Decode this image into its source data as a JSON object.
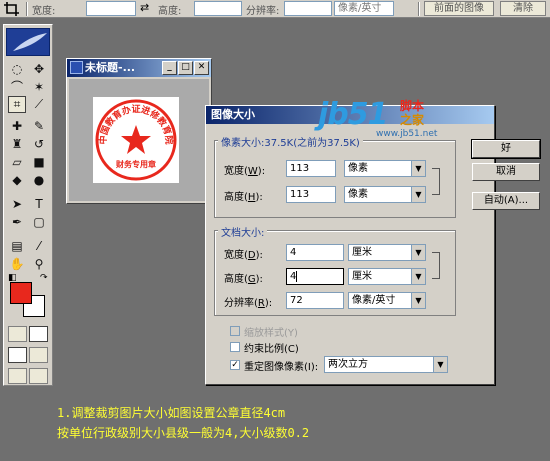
{
  "options_bar": {
    "width_label": "宽度:",
    "height_label": "高度:",
    "resolution_label": "分辨率:",
    "resolution_unit": "像素/英寸",
    "front_image_button": "前面的图像",
    "clear_button": "清除"
  },
  "document": {
    "title": "未标题-...",
    "stamp": {
      "ring_text": "中国教育办证进修教育院",
      "bottom_text": "财务专用章",
      "color": "#e8281d"
    }
  },
  "watermark": {
    "brand": "jb51",
    "cn_top": "脚本",
    "cn_bottom": "之家",
    "url": "www.jb51.net"
  },
  "dialog": {
    "title": "图像大小",
    "pixel_group": {
      "label": "像素大小:37.5K(之前为37.5K)",
      "width_label": "宽度",
      "width_key": "W",
      "width_value": "113",
      "width_unit": "像素",
      "height_label": "高度",
      "height_key": "H",
      "height_value": "113",
      "height_unit": "像素"
    },
    "doc_group": {
      "label": "文档大小:",
      "width_label": "宽度",
      "width_key": "D",
      "width_value": "4",
      "width_unit": "厘米",
      "height_label": "高度",
      "height_key": "G",
      "height_value": "4",
      "height_unit": "厘米",
      "res_label": "分辨率",
      "res_key": "R",
      "res_value": "72",
      "res_unit": "像素/英寸"
    },
    "buttons": {
      "ok": "好",
      "cancel": "取消",
      "auto": "自动(A)..."
    },
    "options": {
      "scale_styles": "缩放样式(Y)",
      "constrain": "约束比例(C)",
      "resample": "重定图像像素(I):",
      "resample_method": "两次立方"
    }
  },
  "instructions": {
    "line1": "1.调整裁剪图片大小如图设置公章直径4cm",
    "line2": "按单位行政级别大小县级一般为4,大小级数0.2"
  },
  "colors": {
    "foreground": "#e8281d",
    "background": "#ffffff",
    "instruction_text": "#ffff33",
    "titlebar": "#0a246a"
  }
}
